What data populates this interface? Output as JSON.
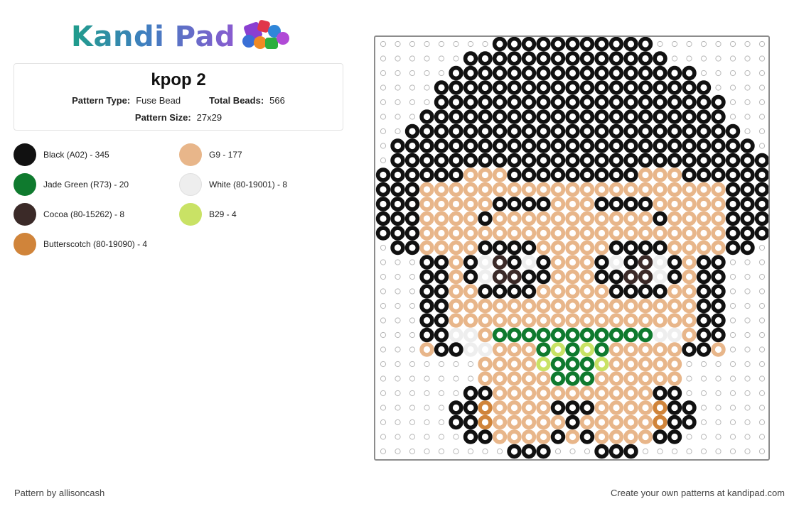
{
  "brand": {
    "logo_text": "Kandi Pad"
  },
  "pattern": {
    "title": "kpop 2",
    "type_label": "Pattern Type:",
    "type_value": "Fuse Bead",
    "total_label": "Total Beads:",
    "total_value": "566",
    "size_label": "Pattern Size:",
    "size_value": "27x29"
  },
  "colors": [
    {
      "name": "Black (A02) - 345",
      "hex": "#111111"
    },
    {
      "name": "Jade Green (R73) - 20",
      "hex": "#0f7a2e"
    },
    {
      "name": "Cocoa (80-15262) - 8",
      "hex": "#3b2a28"
    },
    {
      "name": "Butterscotch (80-19090) - 4",
      "hex": "#d0843a"
    },
    {
      "name": "G9 - 177",
      "hex": "#e8b68a"
    },
    {
      "name": "White (80-19001) - 8",
      "hex": "#eeeeee"
    },
    {
      "name": "B29 - 4",
      "hex": "#c9e265"
    }
  ],
  "footer": {
    "credit": "Pattern by allisoncash",
    "cta": "Create your own patterns at kandipad.com"
  }
}
